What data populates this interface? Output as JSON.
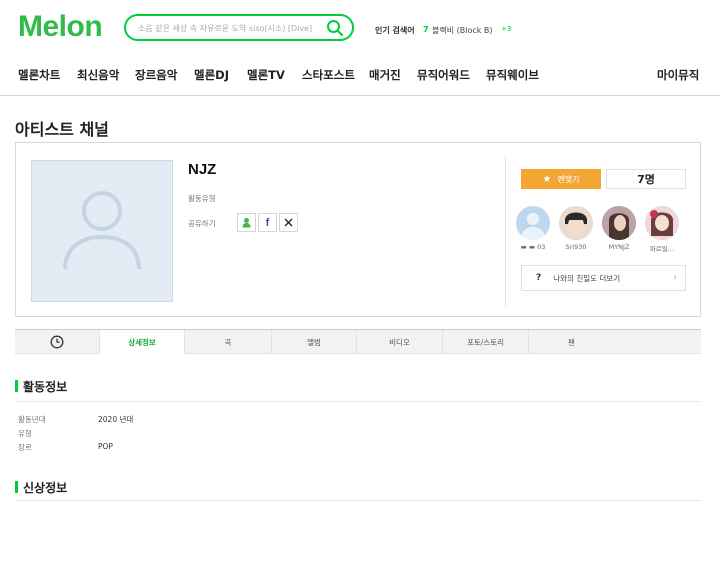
{
  "header": {
    "logo": "Melon",
    "search": {
      "placeholder": "소음 같은 세상 속 자유로운 도약 siso(시소) [Dive]"
    },
    "hot": {
      "label": "인기 검색어",
      "rank": "7",
      "term": "블랙비 (Block B)",
      "change": "+3"
    }
  },
  "gnb": [
    "멜론차트",
    "최신음악",
    "장르음악",
    "멜론DJ",
    "멜론TV",
    "스타포스트",
    "매거진",
    "뮤직어워드",
    "뮤직웨이브",
    "마이뮤직"
  ],
  "page": {
    "title": "아티스트 채널"
  },
  "artist": {
    "name": "NJZ",
    "activity_type_label": "활동유형",
    "share_label": "공유하기",
    "share_icons": [
      "melon-share-icon",
      "facebook-icon",
      "x-icon"
    ],
    "fan_button_label": "팬맺기",
    "fan_count": "7명",
    "fans": [
      {
        "name": "▬ ▬ 03",
        "icon": "default-avatar"
      },
      {
        "name": "Sri930",
        "icon": "user-photo"
      },
      {
        "name": "MYNJZ",
        "icon": "user-photo"
      },
      {
        "name": "파르릴…",
        "icon": "user-photo"
      }
    ],
    "affinity_label": "나와의 친밀도 더보기",
    "affinity_icon": "?"
  },
  "tabs": [
    "",
    "상세정보",
    "곡",
    "앨범",
    "비디오",
    "포토/스토리",
    "팬"
  ],
  "active_tab_index": 1,
  "activity_section": {
    "title": "활동정보",
    "rows": [
      {
        "label": "활동년대",
        "value": "2020 년대"
      },
      {
        "label": "유형",
        "value": ""
      },
      {
        "label": "장르",
        "value": "POP"
      }
    ]
  },
  "profile_section": {
    "title": "신상정보"
  },
  "colors": {
    "brand_green": "#00cd3c",
    "fan_orange": "#f3a634"
  }
}
